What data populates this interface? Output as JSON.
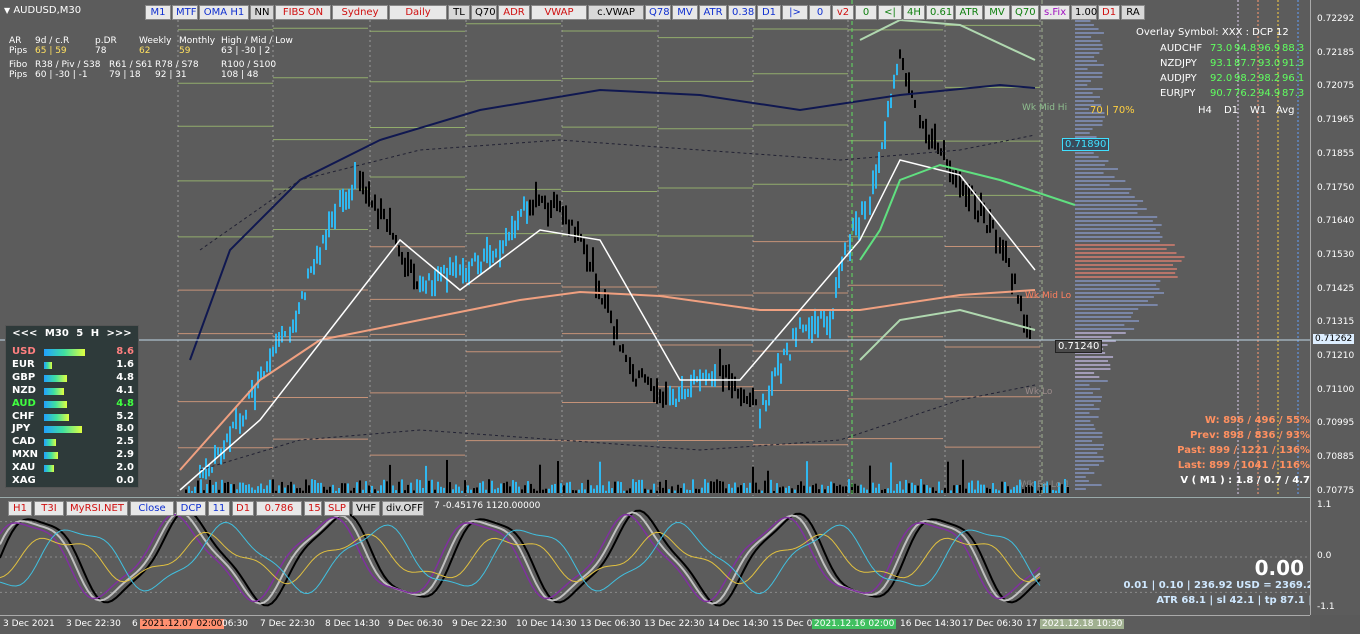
{
  "symbol": "AUDUSD,M30",
  "toolbar_main": [
    {
      "label": "M1",
      "color": "blue"
    },
    {
      "label": "MTF",
      "color": "blue"
    },
    {
      "label": "OMA H1",
      "color": "blue"
    },
    {
      "label": "NN",
      "color": "dark"
    },
    {
      "label": "FIBS ON",
      "color": "red"
    },
    {
      "label": "Sydney",
      "color": "red"
    },
    {
      "label": "Daily",
      "color": "red"
    },
    {
      "label": "TL",
      "color": "dark"
    },
    {
      "label": "Q70",
      "color": "dark"
    },
    {
      "label": "ADR",
      "color": "red"
    },
    {
      "label": "VWAP",
      "color": "red"
    },
    {
      "label": "c.VWAP",
      "color": "dark"
    },
    {
      "label": "Q78",
      "color": "blue"
    },
    {
      "label": "MV",
      "color": "blue"
    },
    {
      "label": "ATR",
      "color": "blue"
    },
    {
      "label": "0.38",
      "color": "blue"
    },
    {
      "label": "D1",
      "color": "blue"
    },
    {
      "label": "|>",
      "color": "blue"
    },
    {
      "label": "0",
      "color": "blue"
    },
    {
      "label": "v2",
      "color": "red"
    },
    {
      "label": "0",
      "color": "green"
    },
    {
      "label": "<|",
      "color": "green"
    },
    {
      "label": "4H",
      "color": "green"
    },
    {
      "label": "0.61",
      "color": "green"
    },
    {
      "label": "ATR",
      "color": "green"
    },
    {
      "label": "MV",
      "color": "green"
    },
    {
      "label": "Q70",
      "color": "green"
    },
    {
      "label": "s.Fix",
      "color": "purple"
    },
    {
      "label": "1.00",
      "color": "dark"
    },
    {
      "label": "D1",
      "color": "red"
    },
    {
      "label": "RA",
      "color": "dark"
    }
  ],
  "toolbar_sub": [
    {
      "label": "H1",
      "color": "red"
    },
    {
      "label": "T3I",
      "color": "red"
    },
    {
      "label": "MyRSI.NET",
      "color": "red"
    },
    {
      "label": "Close",
      "color": "blue"
    },
    {
      "label": "DCP",
      "color": "blue"
    },
    {
      "label": "11",
      "color": "blue"
    },
    {
      "label": "D1",
      "color": "red"
    },
    {
      "label": "0.786",
      "color": "red"
    },
    {
      "label": "15",
      "color": "red"
    },
    {
      "label": "SLP",
      "color": "red"
    },
    {
      "label": "VHF",
      "color": "dark"
    },
    {
      "label": "div.OFF",
      "color": "dark"
    }
  ],
  "sub_readout": "7 -0.45176 1120.00000",
  "info": {
    "row1": [
      "AR",
      "9d / c.R",
      "p.DR",
      "Weekly",
      "Monthly",
      "High / Mid / Low"
    ],
    "row2": [
      "Pips",
      "65 | 59",
      "78",
      "62",
      "59",
      "63  |  -30  |  2"
    ],
    "row3": [
      "Fibo",
      "R38 / Piv / S38",
      "R61 / S61",
      "R78 / S78",
      "R100 / S100"
    ],
    "row4": [
      "Pips",
      "60  |  -30  |  -1",
      "79  |  18",
      "92  |  31",
      "108  |  48"
    ]
  },
  "strength": {
    "header": "<<<   M30  5  H   >>>",
    "rows": [
      {
        "cur": "USD",
        "val": "8.6",
        "color": "#ff8080",
        "level": 0.86
      },
      {
        "cur": "EUR",
        "val": "1.6",
        "color": "#ffffff",
        "level": 0.16
      },
      {
        "cur": "GBP",
        "val": "4.8",
        "color": "#ffffff",
        "level": 0.48
      },
      {
        "cur": "NZD",
        "val": "4.1",
        "color": "#ffffff",
        "level": 0.41
      },
      {
        "cur": "AUD",
        "val": "4.8",
        "color": "#40ff40",
        "level": 0.48
      },
      {
        "cur": "CHF",
        "val": "5.2",
        "color": "#ffffff",
        "level": 0.52
      },
      {
        "cur": "JPY",
        "val": "8.0",
        "color": "#ffffff",
        "level": 0.8
      },
      {
        "cur": "CAD",
        "val": "2.5",
        "color": "#ffffff",
        "level": 0.25
      },
      {
        "cur": "MXN",
        "val": "2.9",
        "color": "#ffffff",
        "level": 0.29
      },
      {
        "cur": "XAU",
        "val": "2.0",
        "color": "#ffffff",
        "level": 0.2
      },
      {
        "cur": "XAG",
        "val": "0.0",
        "color": "#ffffff",
        "level": 0.0
      }
    ]
  },
  "overlay": {
    "title": "Overlay Symbol: XXX : DCP 12",
    "rows": [
      {
        "sym": "AUDCHF",
        "v": [
          "73.0",
          "94.8",
          "96.9",
          "88.3"
        ]
      },
      {
        "sym": "NZDJPY",
        "v": [
          "93.1",
          "87.7",
          "93.0",
          "91.3"
        ]
      },
      {
        "sym": "AUDJPY",
        "v": [
          "92.0",
          "98.2",
          "98.2",
          "96.1"
        ]
      },
      {
        "sym": "EURJPY",
        "v": [
          "90.7",
          "76.2",
          "94.9",
          "87.3"
        ]
      }
    ],
    "footer": [
      "70 | 70%",
      "H4",
      "D1",
      "W1",
      "Avg"
    ]
  },
  "stats": {
    "w": "W: 896 / 496 / 55%",
    "prev": "Prev: 898 / 836 / 93%",
    "past": "Past: 899 / 1221 / 136%",
    "last": "Last: 899 / 1041 / 116%",
    "v": "V ( M1 ) : 1.8 / 0.7 / 4.7"
  },
  "bottom": {
    "big": "0.00",
    "line1": "0.01  |  0.10  |  236.92 USD = 2369.2  |  2.0%",
    "line2": "ATR 68.1  |  sl 42.1  |  tp 87.1  |  N 0.56"
  },
  "price_ticks": [
    "0.72292",
    "0.72185",
    "0.72075",
    "0.71965",
    "0.71855",
    "0.71750",
    "0.71640",
    "0.71530",
    "0.71425",
    "0.71315",
    "0.71210",
    "0.71100",
    "0.70995",
    "0.70885",
    "0.70775"
  ],
  "current_price": "0.71262",
  "price_labels": {
    "upper": "0.71890",
    "lower": "0.71240"
  },
  "sub_ticks": [
    "1.1",
    "0.0",
    "-1.1"
  ],
  "time_labels": [
    "3 Dec 2021",
    "3 Dec 22:30",
    "6",
    "2021.12.07 02:00",
    "06:30",
    "7 Dec 22:30",
    "8 Dec 14:30",
    "9 Dec 06:30",
    "9 Dec 22:30",
    "10 Dec 14:30",
    "13 Dec 06:30",
    "13 Dec 22:30",
    "14 Dec 14:30",
    "15 Dec 06",
    "2021.12.16 02:00",
    "16 Dec 14:30",
    "17 Dec 06:30",
    "17",
    "2021.12.18 10:30"
  ],
  "chart_levels": {
    "wk": [
      "Wk Mid Hi",
      "Wk Mid Lo",
      "Wk Lo",
      "Wk Ex Lo 1"
    ]
  }
}
